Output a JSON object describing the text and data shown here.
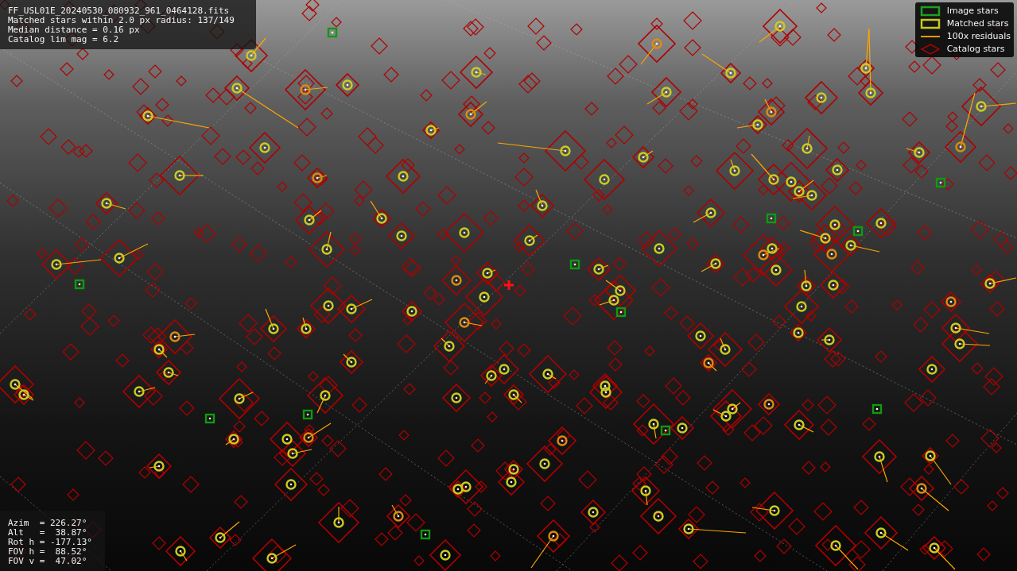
{
  "info_box": {
    "lines": [
      "FF_USL01E_20240530_080932_961_0464128.fits",
      "Matched stars within 2.0 px radius: 137/149",
      "Median distance = 0.16 px",
      "Catalog lim mag = 6.2"
    ]
  },
  "legend": {
    "items": [
      {
        "label": "Image stars",
        "kind": "box",
        "color": "#1e9e1e"
      },
      {
        "label": "Matched stars",
        "kind": "box",
        "color": "#c8c81e"
      },
      {
        "label": "100x residuals",
        "kind": "line",
        "color": "#ff9900"
      },
      {
        "label": "Catalog stars",
        "kind": "diamond",
        "color": "#b00000"
      }
    ]
  },
  "pointing_box": {
    "lines": [
      "Azim  = 226.27°",
      "Alt   =  38.87°",
      "Rot h = -177.13°",
      "FOV h =  88.52°",
      "FOV v =  47.02°"
    ]
  }
}
